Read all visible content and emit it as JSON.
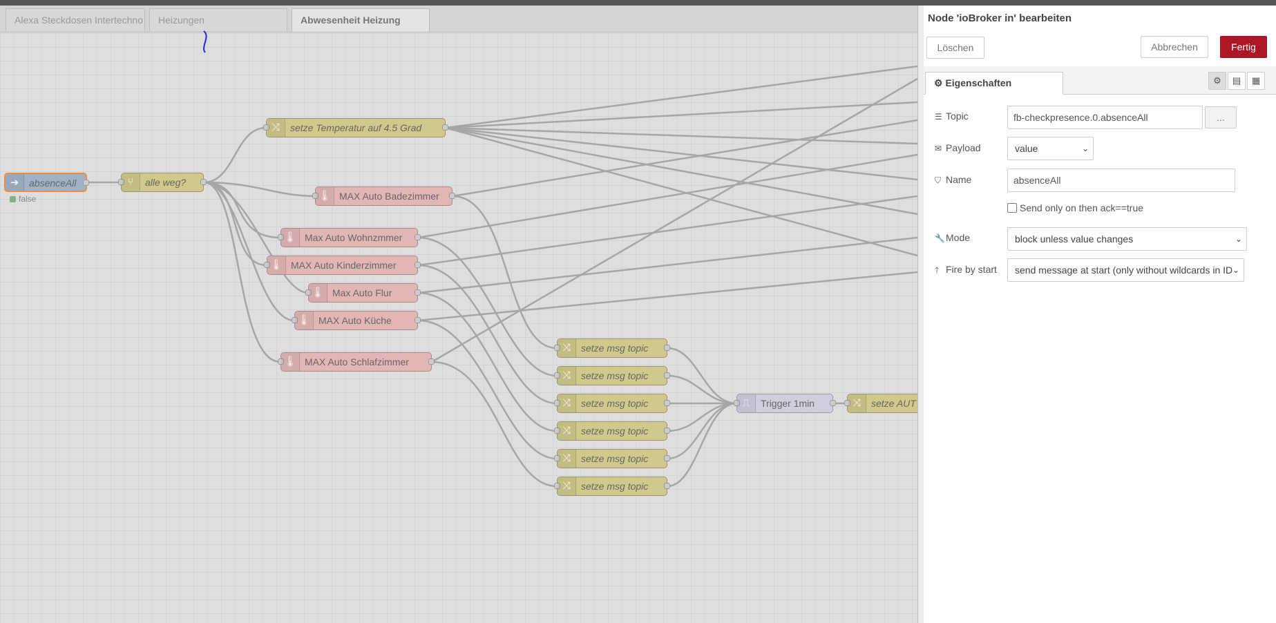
{
  "workspace": {
    "tabs": [
      {
        "label": "Alexa Steckdosen Intertechno"
      },
      {
        "label": "Heizungen"
      },
      {
        "label": "Abwesenheit Heizung"
      }
    ],
    "nodes": {
      "absence": "absenceAll",
      "absence_status": "false",
      "switch": "alle weg?",
      "set_temp": "setze Temperatur auf 4.5 Grad",
      "max_bad": "MAX Auto Badezimmer",
      "max_wohn": "Max Auto Wohnzmmer",
      "max_kinder": "MAX Auto Kinderzimmer",
      "max_flur": "Max Auto Flur",
      "max_kueche": "MAX Auto Küche",
      "max_schlaf": "MAX Auto Schlafzimmer",
      "topic1": "setze msg topic",
      "topic2": "setze msg topic",
      "topic3": "setze msg topic",
      "topic4": "setze msg topic",
      "topic5": "setze msg topic",
      "topic6": "setze msg topic",
      "trigger": "Trigger 1min",
      "setze_auto": "setze AUT"
    },
    "node_colors": {
      "change": "#cfc98b",
      "max": "#e3b6b6",
      "trigger": "#cfcfdc",
      "iobroker_in": "#9fb3c8",
      "selected_border": "#f28b3e"
    }
  },
  "panel": {
    "title": "Node 'ioBroker in' bearbeiten",
    "delete_label": "Löschen",
    "cancel_label": "Abbrechen",
    "done_label": "Fertig",
    "properties_tab": "Eigenschaften",
    "fields": {
      "topic_label": "Topic",
      "topic_value": "fb-checkpresence.0.absenceAll",
      "topic_browse": "...",
      "payload_label": "Payload",
      "payload_value": "value",
      "name_label": "Name",
      "name_value": "absenceAll",
      "ack_label": "Send only on then ack==true",
      "mode_label": "Mode",
      "mode_value": "block unless value changes",
      "fire_label": "Fire by start",
      "fire_value": "send message at start (only without wildcards in ID"
    },
    "accent_color": "#ad1625"
  }
}
